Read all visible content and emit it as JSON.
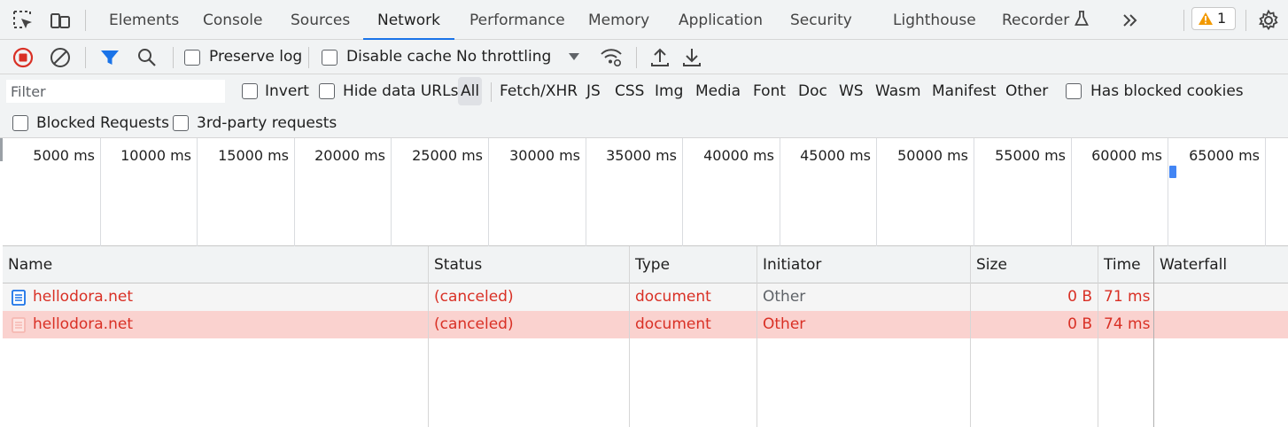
{
  "tabs": [
    {
      "label": "Elements"
    },
    {
      "label": "Console"
    },
    {
      "label": "Sources"
    },
    {
      "label": "Network",
      "active": true
    },
    {
      "label": "Performance"
    },
    {
      "label": "Memory"
    },
    {
      "label": "Application"
    },
    {
      "label": "Security"
    },
    {
      "label": "Lighthouse"
    },
    {
      "label": "Recorder"
    }
  ],
  "issues_badge": {
    "count": "1",
    "icon": "warning-triangle-icon",
    "color": "#f29900"
  },
  "toolbar": {
    "preserve_log": "Preserve log",
    "disable_cache": "Disable cache",
    "throttling": "No throttling"
  },
  "filter": {
    "placeholder": "Filter",
    "invert": "Invert",
    "hide_data_urls": "Hide data URLs",
    "types": [
      "All",
      "Fetch/XHR",
      "JS",
      "CSS",
      "Img",
      "Media",
      "Font",
      "Doc",
      "WS",
      "Wasm",
      "Manifest",
      "Other"
    ],
    "selected_type": "All",
    "has_blocked_cookies": "Has blocked cookies",
    "blocked_requests": "Blocked Requests",
    "third_party": "3rd-party requests"
  },
  "overview_ticks": [
    "5000 ms",
    "10000 ms",
    "15000 ms",
    "20000 ms",
    "25000 ms",
    "30000 ms",
    "35000 ms",
    "40000 ms",
    "45000 ms",
    "50000 ms",
    "55000 ms",
    "60000 ms",
    "65000 ms"
  ],
  "table": {
    "columns": [
      "Name",
      "Status",
      "Type",
      "Initiator",
      "Size",
      "Time",
      "Waterfall"
    ],
    "rows": [
      {
        "name": "hellodora.net",
        "status": "(canceled)",
        "type": "document",
        "initiator": "Other",
        "size": "0 B",
        "time": "71 ms"
      },
      {
        "name": "hellodora.net",
        "status": "(canceled)",
        "type": "document",
        "initiator": "Other",
        "size": "0 B",
        "time": "74 ms"
      }
    ]
  },
  "colors": {
    "accent": "#1a73e8",
    "error": "#d93025",
    "record": "#d93025",
    "selected_row": "#fad2cf"
  }
}
